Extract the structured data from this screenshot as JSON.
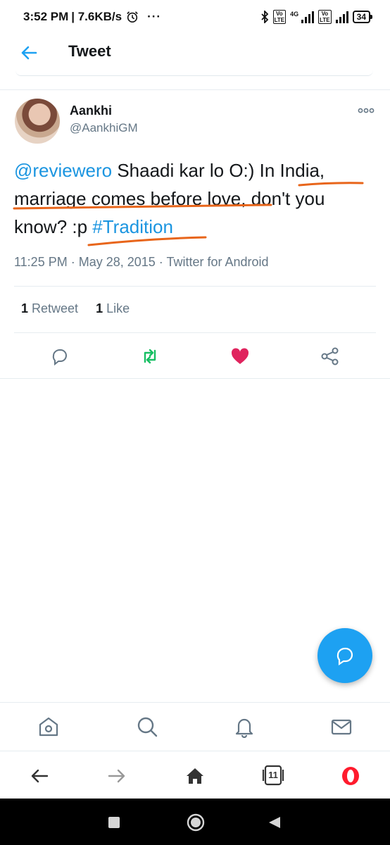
{
  "status_bar": {
    "time": "3:52 PM",
    "speed": "| 7.6KB/s",
    "more": "···",
    "network": "4G",
    "volte_label": "Vo LTE",
    "battery": "34"
  },
  "header": {
    "title": "Tweet",
    "icon": "back-arrow-icon"
  },
  "tweet": {
    "author_name": "Aankhi",
    "author_handle": "@AankhiGM",
    "text_mention": "@reviewero",
    "text_body_1": " Shaadi kar lo O:) In India, marriage comes before love, don't you know? :p ",
    "text_hashtag": "#Tradition",
    "timestamp": "11:25 PM · May 28, 2015 · Twitter for Android",
    "retweet_count": "1",
    "retweet_label": " Retweet",
    "like_count": "1",
    "like_label": " Like",
    "annotation_color": "#e8651a"
  },
  "actions": {
    "reply_icon": "reply-icon",
    "retweet_icon": "retweet-icon",
    "like_icon": "heart-icon",
    "share_icon": "share-icon",
    "retweet_color": "#17bf63",
    "like_color": "#e0245e"
  },
  "colors": {
    "accent": "#1da1f2",
    "link": "#1b95e0",
    "secondary_text": "#657786"
  },
  "browser": {
    "tabs_count": "11"
  }
}
